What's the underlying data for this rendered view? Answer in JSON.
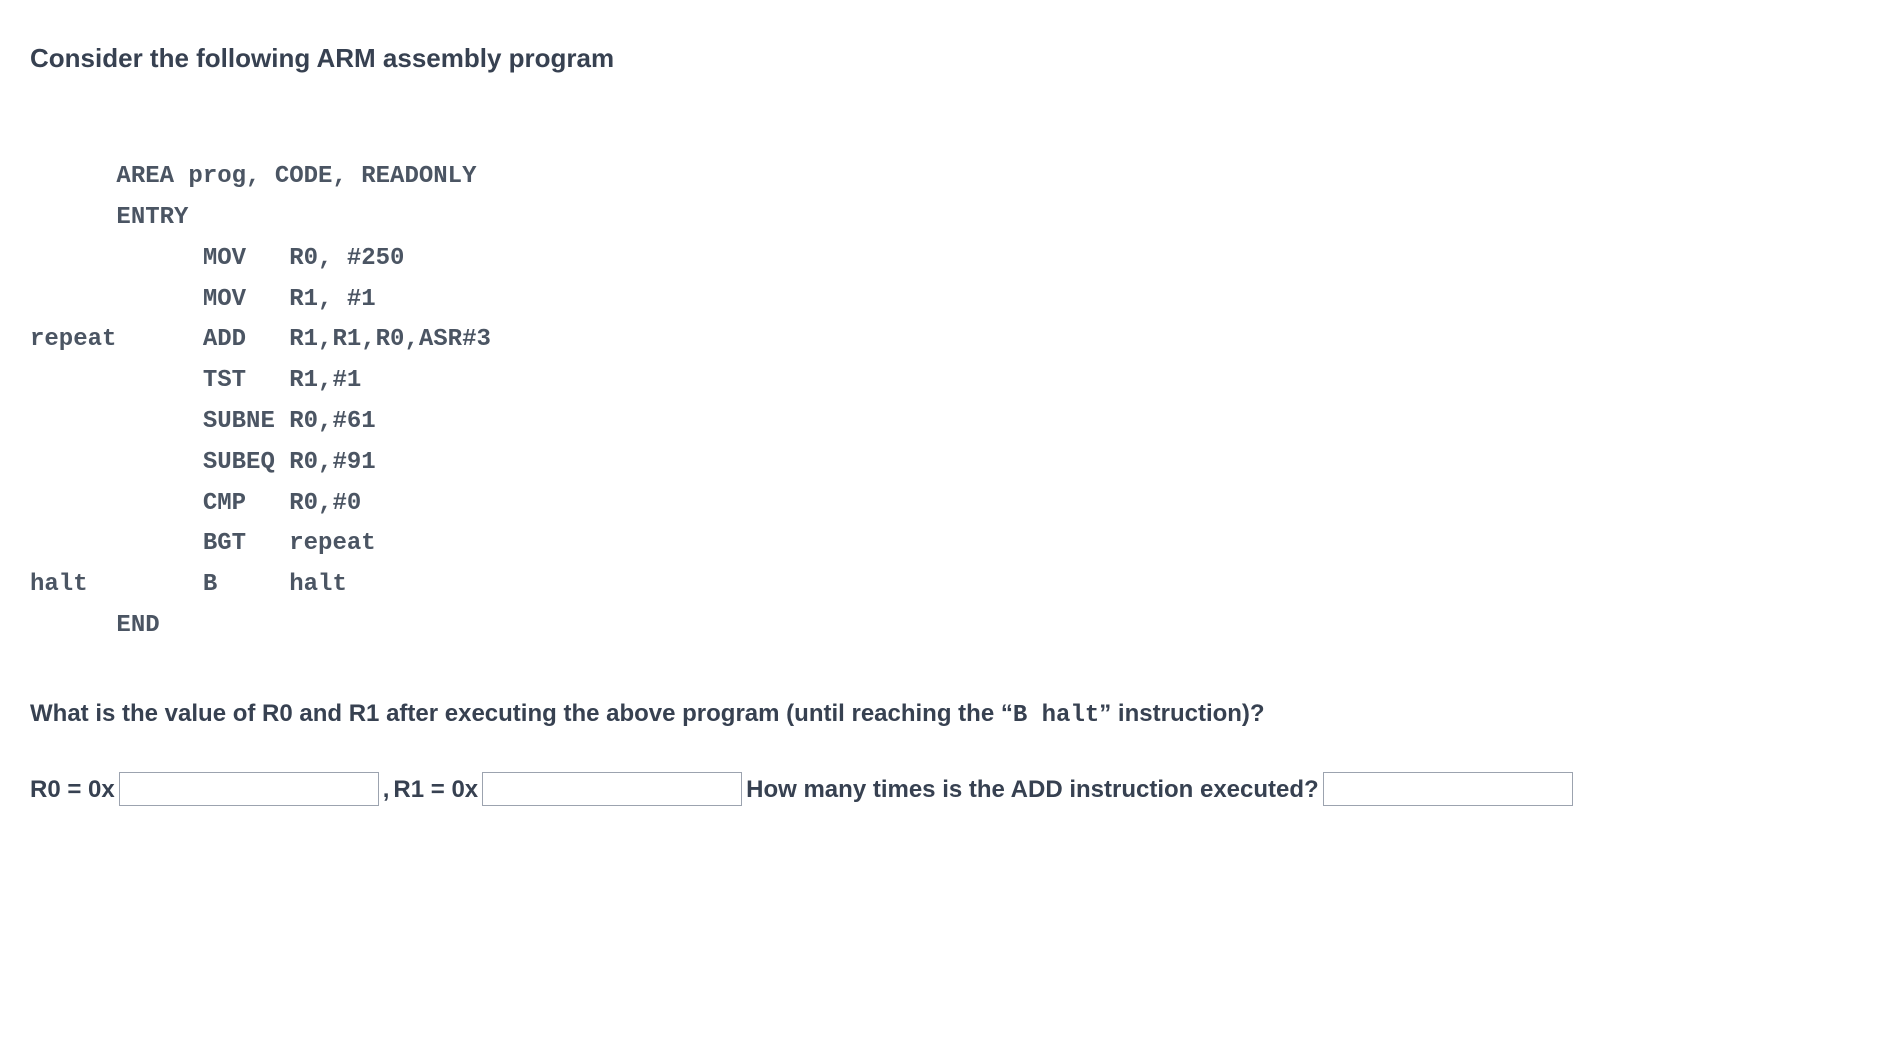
{
  "heading": "Consider the following ARM assembly program",
  "code": {
    "l1": "      AREA prog, CODE, READONLY",
    "l2": "      ENTRY",
    "l3": "            MOV   R0, #250",
    "l4": "            MOV   R1, #1",
    "l5": "repeat      ADD   R1,R1,R0,ASR#3",
    "l6": "            TST   R1,#1",
    "l7": "            SUBNE R0,#61",
    "l8": "            SUBEQ R0,#91",
    "l9": "            CMP   R0,#0",
    "l10": "            BGT   repeat",
    "l11": "halt        B     halt",
    "l12": "      END"
  },
  "question": {
    "pre": "What is the value of R0 and R1 after executing the above program (until reaching the  “",
    "mono": "B halt",
    "post": "” instruction)?"
  },
  "answers": {
    "r0_label": "R0 = 0x ",
    "comma": " , ",
    "r1_label": "R1 = 0x ",
    "count_label": " How many times is the ADD instruction executed? "
  }
}
